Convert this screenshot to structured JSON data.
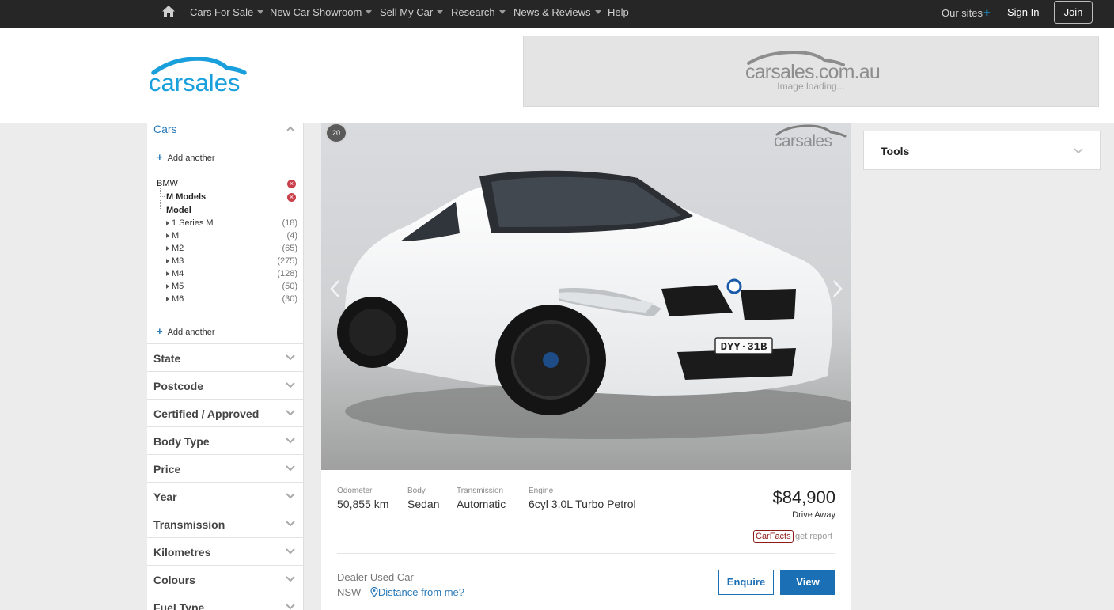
{
  "nav": {
    "items": [
      {
        "label": "Cars For Sale",
        "dropdown": true
      },
      {
        "label": "New Car Showroom",
        "dropdown": true
      },
      {
        "label": "Sell My Car",
        "dropdown": true
      },
      {
        "label": "Research",
        "dropdown": true
      },
      {
        "label": "News & Reviews",
        "dropdown": true
      },
      {
        "label": "Help",
        "dropdown": false
      }
    ],
    "our_sites": "Our sites",
    "sign_in": "Sign In",
    "join": "Join"
  },
  "brand": {
    "logo_text": "carsales",
    "accent": "#1a9fdd"
  },
  "ad": {
    "logo_text": "carsales.com.au",
    "loading_text": "Image loading..."
  },
  "sidebar": {
    "section_title": "Cars",
    "add_another": "Add another",
    "make": "BMW",
    "family": "M Models",
    "model_heading": "Model",
    "models": [
      {
        "name": "1 Series M",
        "count": "(18)"
      },
      {
        "name": "M",
        "count": "(4)"
      },
      {
        "name": "M2",
        "count": "(65)"
      },
      {
        "name": "M3",
        "count": "(275)"
      },
      {
        "name": "M4",
        "count": "(128)"
      },
      {
        "name": "M5",
        "count": "(50)"
      },
      {
        "name": "M6",
        "count": "(30)"
      }
    ],
    "filters": [
      "State",
      "Postcode",
      "Certified / Approved",
      "Body Type",
      "Price",
      "Year",
      "Transmission",
      "Kilometres",
      "Colours",
      "Fuel Type"
    ]
  },
  "listing": {
    "photo_count": "20",
    "watermark": "carsales",
    "plate": "DYY·31B",
    "specs": [
      {
        "label": "Odometer",
        "value": "50,855 km"
      },
      {
        "label": "Body",
        "value": "Sedan"
      },
      {
        "label": "Transmission",
        "value": "Automatic"
      },
      {
        "label": "Engine",
        "value": "6cyl 3.0L Turbo Petrol"
      }
    ],
    "price": "$84,900",
    "price_type": "Drive Away",
    "carfacts": "CarFacts",
    "get_report": "get report",
    "seller_type": "Dealer Used Car",
    "state": "NSW -",
    "distance_link": "Distance from me?",
    "enquire": "Enquire",
    "view": "View"
  },
  "tools": {
    "label": "Tools"
  }
}
